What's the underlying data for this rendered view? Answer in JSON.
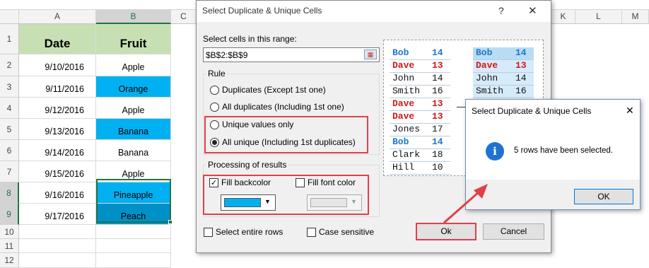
{
  "sheet": {
    "columns": [
      "A",
      "B",
      "C",
      "K",
      "L",
      "M"
    ],
    "header_date": "Date",
    "header_fruit": "Fruit",
    "row_numbers": [
      "1",
      "2",
      "3",
      "4",
      "5",
      "6",
      "7",
      "8",
      "9",
      "10",
      "11",
      "12"
    ],
    "rows": [
      {
        "date": "9/10/2016",
        "fruit": "Apple"
      },
      {
        "date": "9/11/2016",
        "fruit": "Orange"
      },
      {
        "date": "9/12/2016",
        "fruit": "Apple"
      },
      {
        "date": "9/13/2016",
        "fruit": "Banana"
      },
      {
        "date": "9/14/2016",
        "fruit": "Banana"
      },
      {
        "date": "9/15/2016",
        "fruit": "Apple"
      },
      {
        "date": "9/16/2016",
        "fruit": "Pineapple"
      },
      {
        "date": "9/17/2016",
        "fruit": "Peach"
      }
    ],
    "colors": {
      "header_green": "#c6e0b4",
      "fill_blue": "#00b0f0",
      "fill_blue_dark": "#0090c8"
    }
  },
  "dialog": {
    "title": "Select Duplicate & Unique Cells",
    "help_glyph": "?",
    "close_glyph": "✕",
    "range_label": "Select cells in this range:",
    "range_value": "$B$2:$B$9",
    "rule_label": "Rule",
    "rule_options": [
      {
        "label": "Duplicates (Except 1st one)",
        "selected": false
      },
      {
        "label": "All duplicates (Including 1st one)",
        "selected": false
      },
      {
        "label": "Unique values only",
        "selected": false
      },
      {
        "label": "All unique (Including 1st duplicates)",
        "selected": true
      }
    ],
    "processing_label": "Processing of results",
    "fill_backcolor_label": "Fill backcolor",
    "fill_backcolor_checked": true,
    "fill_fontcolor_label": "Fill font color",
    "fill_fontcolor_checked": false,
    "select_rows_label": "Select entire rows",
    "case_sensitive_label": "Case sensitive",
    "ok_label": "Ok",
    "cancel_label": "Cancel",
    "accent_red": "#e0404a",
    "preview_left": [
      {
        "name": "Bob",
        "n": "14",
        "style": "blue"
      },
      {
        "name": "Dave",
        "n": "13",
        "style": "red"
      },
      {
        "name": "John",
        "n": "14",
        "style": "plain"
      },
      {
        "name": "Smith",
        "n": "16",
        "style": "plain"
      },
      {
        "name": "Dave",
        "n": "13",
        "style": "red"
      },
      {
        "name": "Dave",
        "n": "13",
        "style": "red"
      },
      {
        "name": "Jones",
        "n": "17",
        "style": "plain"
      },
      {
        "name": "Bob",
        "n": "14",
        "style": "blue"
      },
      {
        "name": "Clark",
        "n": "18",
        "style": "plain"
      },
      {
        "name": "Hill",
        "n": "10",
        "style": "plain"
      }
    ],
    "preview_right": [
      {
        "name": "Bob",
        "n": "14",
        "style": "blue"
      },
      {
        "name": "Dave",
        "n": "13",
        "style": "red"
      },
      {
        "name": "John",
        "n": "14",
        "style": "plain"
      },
      {
        "name": "Smith",
        "n": "16",
        "style": "plain"
      }
    ]
  },
  "message": {
    "title": "Select Duplicate & Unique Cells",
    "close_glyph": "✕",
    "icon_glyph": "i",
    "text": "5 rows have been selected.",
    "ok_label": "OK"
  }
}
